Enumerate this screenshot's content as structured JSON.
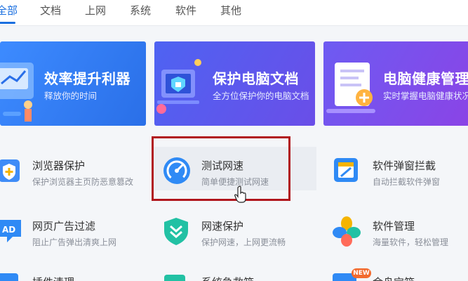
{
  "tabs": [
    {
      "label": "全部",
      "active": true
    },
    {
      "label": "文档",
      "active": false
    },
    {
      "label": "上网",
      "active": false
    },
    {
      "label": "系统",
      "active": false
    },
    {
      "label": "软件",
      "active": false
    },
    {
      "label": "其他",
      "active": false
    }
  ],
  "banners": [
    {
      "title": "效率提升利器",
      "subtitle": "释放你的时间",
      "color": "#2f7bf5"
    },
    {
      "title": "保护电脑文档",
      "subtitle": "全方位保护你的电脑文档",
      "color": "#5a52e8"
    },
    {
      "title": "电脑健康管理",
      "subtitle": "实时掌握电脑健康状况",
      "color": "#7a4ff0"
    }
  ],
  "tools": [
    {
      "name": "浏览器保护",
      "desc": "保护浏览器主页防恶意篡改",
      "icon": "browser-shield-icon"
    },
    {
      "name": "测试网速",
      "desc": "简单便捷测试网速",
      "icon": "speedometer-icon"
    },
    {
      "name": "软件弹窗拦截",
      "desc": "自动拦截软件弹窗",
      "icon": "popup-block-icon"
    },
    {
      "name": "网页广告过滤",
      "desc": "阻止广告弹出清爽上网",
      "icon": "ad-filter-icon"
    },
    {
      "name": "网速保护",
      "desc": "保护网速，上网更流畅",
      "icon": "speed-shield-icon"
    },
    {
      "name": "软件管理",
      "desc": "海量软件，轻松管理",
      "icon": "software-manager-icon"
    }
  ],
  "partial_row": {
    "item1": "插件清理",
    "item2": "系统急救箱",
    "item3": "金舟宝箱",
    "badge": "NEW"
  }
}
